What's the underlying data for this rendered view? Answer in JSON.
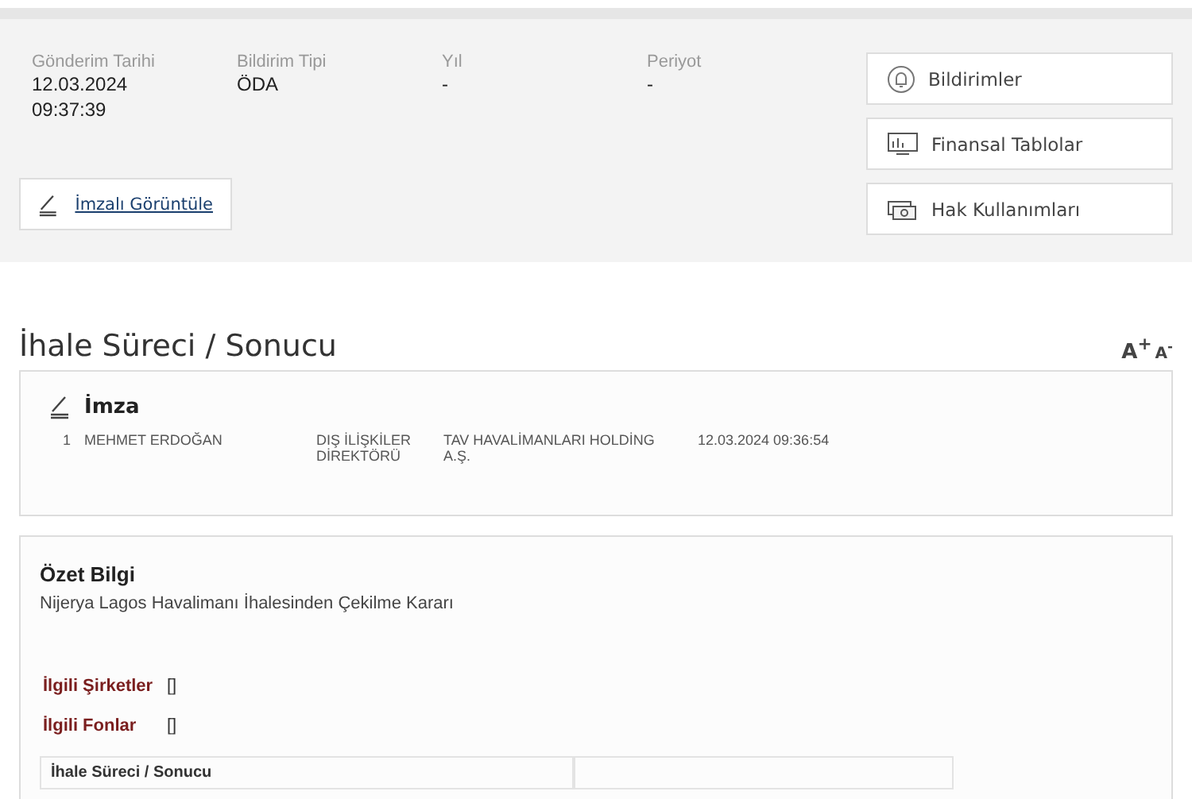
{
  "meta": [
    {
      "label": "Gönderim Tarihi",
      "value": "12.03.2024\n09:37:39"
    },
    {
      "label": "Bildirim Tipi",
      "value": "ÖDA"
    },
    {
      "label": "Yıl",
      "value": "-"
    },
    {
      "label": "Periyot",
      "value": "-"
    }
  ],
  "signed_view_link": "İmzalı Görüntüle",
  "side_buttons": [
    {
      "kind": "bell",
      "label": "Bildirimler"
    },
    {
      "kind": "monitor",
      "label": "Finansal Tablolar"
    },
    {
      "kind": "money",
      "label": "Hak Kullanımları"
    }
  ],
  "title": "İhale Süreci / Sonucu",
  "font_controls": {
    "increase": "A$^{+}$",
    "decrease": "A$^{-}$"
  },
  "signature": {
    "heading": "İmza",
    "rows": [
      {
        "no": "1",
        "name": "MEHMET ERDOĞAN",
        "role": "DIŞ İLİŞKİLER DİREKTÖRÜ",
        "company": "TAV HAVALİMANLARI HOLDİNG A.Ş.",
        "time": "12.03.2024 09:36:54"
      }
    ]
  },
  "summary": {
    "heading": "Özet Bilgi",
    "text": "Nijerya Lagos Havalimanı İhalesinden Çekilme Kararı"
  },
  "related": [
    {
      "label": "İlgili Şirketler",
      "value": "[]"
    },
    {
      "label": "İlgili Fonlar",
      "value": "[]"
    }
  ],
  "table_header": "İhale Süreci / Sonucu"
}
